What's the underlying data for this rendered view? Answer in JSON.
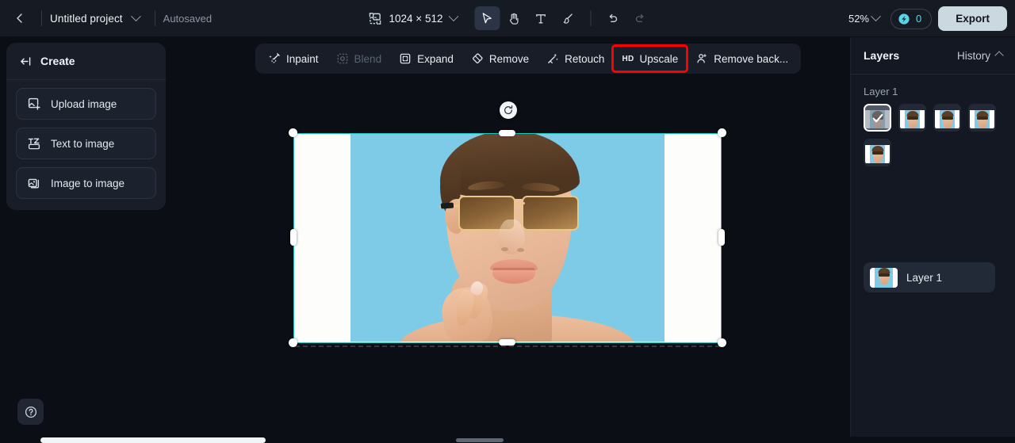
{
  "topbar": {
    "back_icon": "chevron-left-icon",
    "project_name": "Untitled project",
    "project_caret_icon": "chevron-down-icon",
    "autosaved_label": "Autosaved",
    "canvas_resize_icon": "canvas-resize-icon",
    "canvas_size_label": "1024 × 512",
    "canvas_size_caret_icon": "chevron-down-icon",
    "tools": [
      {
        "name": "select-tool",
        "icon": "cursor-arrow-icon",
        "active": true,
        "disabled": false
      },
      {
        "name": "hand-tool",
        "icon": "hand-icon",
        "active": false,
        "disabled": false
      },
      {
        "name": "text-tool",
        "icon": "text-t-icon",
        "active": false,
        "disabled": false
      },
      {
        "name": "brush-tool",
        "icon": "brush-icon",
        "active": false,
        "disabled": false
      },
      {
        "name": "undo-tool",
        "icon": "undo-arrow-icon",
        "active": false,
        "disabled": false
      },
      {
        "name": "redo-tool",
        "icon": "redo-arrow-icon",
        "active": false,
        "disabled": true
      }
    ],
    "zoom_label": "52%",
    "zoom_caret_icon": "chevron-down-icon",
    "credits_icon": "credit-coin-icon",
    "credits_value": "0",
    "export_label": "Export"
  },
  "sidebar": {
    "collapse_icon": "collapse-panel-icon",
    "title": "Create",
    "items": [
      {
        "label": "Upload image",
        "icon": "upload-image-icon"
      },
      {
        "label": "Text to image",
        "icon": "text-to-image-icon"
      },
      {
        "label": "Image to image",
        "icon": "image-to-image-icon"
      }
    ],
    "help_icon": "question-mark-icon"
  },
  "edit_toolbar": {
    "items": [
      {
        "label": "Inpaint",
        "icon": "magic-wand-icon",
        "disabled": false,
        "highlighted": false
      },
      {
        "label": "Blend",
        "icon": "blend-frame-icon",
        "disabled": true,
        "highlighted": false
      },
      {
        "label": "Expand",
        "icon": "expand-frame-icon",
        "disabled": false,
        "highlighted": false
      },
      {
        "label": "Remove",
        "icon": "eraser-icon",
        "disabled": false,
        "highlighted": false
      },
      {
        "label": "Retouch",
        "icon": "retouch-sparkle-icon",
        "disabled": false,
        "highlighted": false
      },
      {
        "label": "Upscale",
        "icon": "hd-badge-icon",
        "disabled": false,
        "highlighted": true
      },
      {
        "label": "Remove back...",
        "icon": "remove-background-icon",
        "disabled": false,
        "highlighted": false
      }
    ],
    "hd_badge_text": "HD",
    "highlight_color": "#ff0000"
  },
  "canvas": {
    "selection_border_color": "#22c6bf",
    "image_background_color": "#7ecbe8",
    "padding_color": "#ffffff",
    "rotate_icon": "rotate-handle-icon",
    "handles": [
      "corner-handle-top-left",
      "corner-handle-top-right",
      "corner-handle-bottom-left",
      "corner-handle-bottom-right",
      "edge-handle-top",
      "edge-handle-bottom",
      "edge-handle-left",
      "edge-handle-right"
    ]
  },
  "right_panel": {
    "title": "Layers",
    "history_label": "History",
    "history_caret_icon": "chevron-up-icon",
    "section_label": "Layer 1",
    "thumbnails": [
      {
        "name": "layer-thumbnail-1",
        "selected": true
      },
      {
        "name": "layer-thumbnail-2",
        "selected": false
      },
      {
        "name": "layer-thumbnail-3",
        "selected": false
      },
      {
        "name": "layer-thumbnail-4",
        "selected": false
      },
      {
        "name": "layer-thumbnail-5",
        "selected": false
      }
    ],
    "selected_check_icon": "check-icon",
    "layer_row_label": "Layer 1"
  },
  "scrollbars": {
    "horizontal_primary": "page-horizontal-scrollbar",
    "horizontal_secondary": "panel-horizontal-scrollbar"
  }
}
